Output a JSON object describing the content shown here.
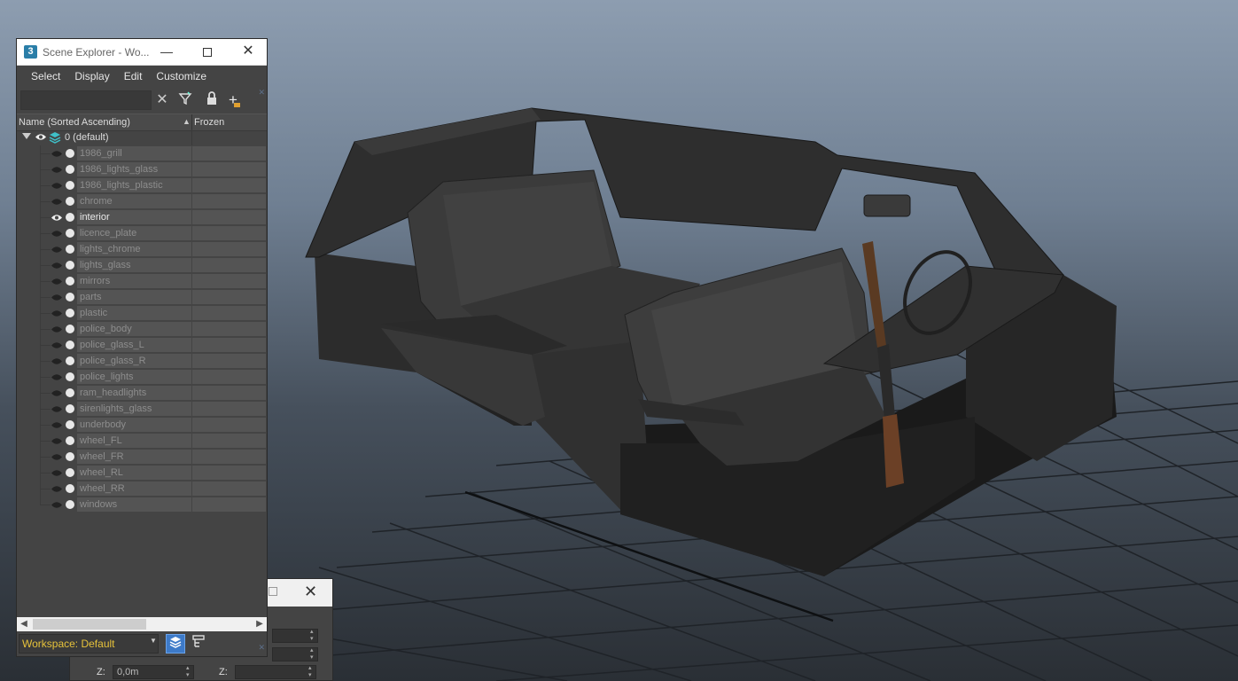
{
  "scene_explorer": {
    "title": "Scene Explorer - Wo...",
    "menu": [
      "Select",
      "Display",
      "Edit",
      "Customize"
    ],
    "search": {
      "value": "",
      "placeholder": ""
    },
    "columns": {
      "name": "Name (Sorted Ascending)",
      "frozen": "Frozen"
    },
    "layer": {
      "label": "0 (default)"
    },
    "objects": [
      {
        "name": "1986_grill"
      },
      {
        "name": "1986_lights_glass"
      },
      {
        "name": "1986_lights_plastic"
      },
      {
        "name": "chrome"
      },
      {
        "name": "interior"
      },
      {
        "name": "licence_plate"
      },
      {
        "name": "lights_chrome"
      },
      {
        "name": "lights_glass"
      },
      {
        "name": "mirrors"
      },
      {
        "name": "parts"
      },
      {
        "name": "plastic"
      },
      {
        "name": "police_body"
      },
      {
        "name": "police_glass_L"
      },
      {
        "name": "police_glass_R"
      },
      {
        "name": "police_lights"
      },
      {
        "name": "ram_headlights"
      },
      {
        "name": "sirenlights_glass"
      },
      {
        "name": "underbody"
      },
      {
        "name": "wheel_FL"
      },
      {
        "name": "wheel_FR"
      },
      {
        "name": "wheel_RL"
      },
      {
        "name": "wheel_RR"
      },
      {
        "name": "windows"
      }
    ],
    "active_object": "interior",
    "workspace": "Workspace: Default"
  },
  "coord_dialog": {
    "z_label": "Z:",
    "z_value_1": "0,0m",
    "z_label_2": "Z:",
    "z_value_2": ""
  },
  "colors": {
    "workspace_text": "#e6c23a",
    "active_button": "#3d7ac8",
    "viewport_top": "#8d9db0",
    "viewport_bottom": "#2a2f35"
  }
}
